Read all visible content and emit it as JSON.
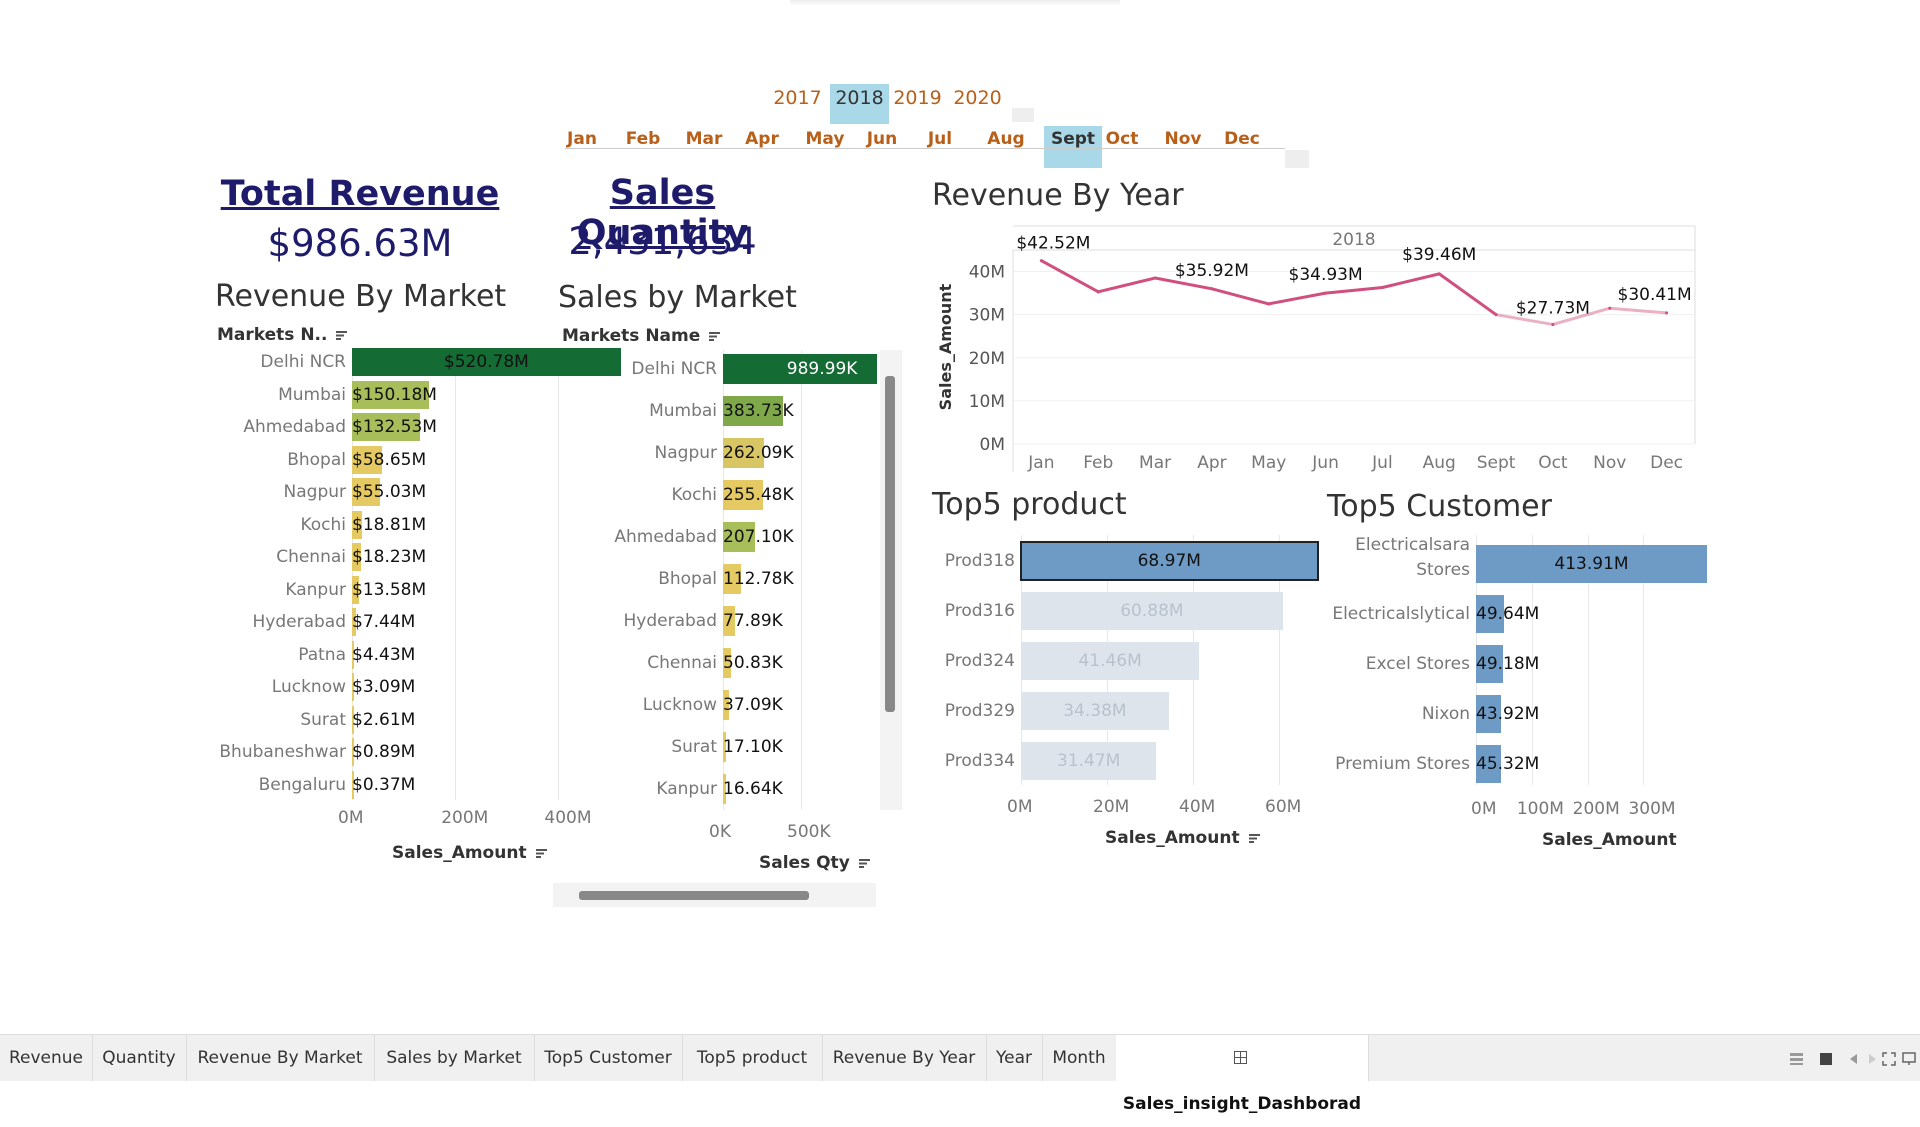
{
  "filters": {
    "years": [
      "2017",
      "2018",
      "2019",
      "2020"
    ],
    "selected_year": "2018",
    "months": [
      "Jan",
      "Feb",
      "Mar",
      "Apr",
      "May",
      "Jun",
      "Jul",
      "Aug",
      "Sept",
      "Oct",
      "Nov",
      "Dec"
    ],
    "selected_month": "Sept"
  },
  "kpis": {
    "revenue_title": "Total Revenue",
    "revenue_value": "$986.63M",
    "quantity_title": "Sales Quantity",
    "quantity_value": "2,431,634"
  },
  "chart_data": [
    {
      "id": "revenue_by_market",
      "type": "bar",
      "title": "Revenue By Market",
      "category_header": "Markets N..",
      "xlabel": "Sales_Amount",
      "xlim": [
        0,
        500
      ],
      "ticks": [
        "0M",
        "200M",
        "400M"
      ],
      "categories": [
        "Delhi NCR",
        "Mumbai",
        "Ahmedabad",
        "Bhopal",
        "Nagpur",
        "Kochi",
        "Chennai",
        "Kanpur",
        "Hyderabad",
        "Patna",
        "Lucknow",
        "Surat",
        "Bhubaneshwar",
        "Bengaluru"
      ],
      "values": [
        520.78,
        150.18,
        132.53,
        58.65,
        55.03,
        18.81,
        18.23,
        13.58,
        7.44,
        4.43,
        3.09,
        2.61,
        0.89,
        0.37
      ],
      "labels": [
        "$520.78M",
        "$150.18M",
        "$132.53M",
        "$58.65M",
        "$55.03M",
        "$18.81M",
        "$18.23M",
        "$13.58M",
        "$7.44M",
        "$4.43M",
        "$3.09M",
        "$2.61M",
        "$0.89M",
        "$0.37M"
      ],
      "colors": [
        "#156b34",
        "#a7be5a",
        "#a7be5a",
        "#e5c962",
        "#e5c962",
        "#e5c962",
        "#e5c962",
        "#e5c962",
        "#e5c962",
        "#e5c962",
        "#e5c962",
        "#e5c962",
        "#e5c962",
        "#e5c962"
      ]
    },
    {
      "id": "sales_by_market",
      "type": "bar",
      "title": "Sales by Market",
      "category_header": "Markets Name",
      "xlabel": "Sales Qty",
      "xlim": [
        0,
        1000
      ],
      "ticks": [
        "0K",
        "500K"
      ],
      "categories": [
        "Delhi NCR",
        "Mumbai",
        "Nagpur",
        "Kochi",
        "Ahmedabad",
        "Bhopal",
        "Hyderabad",
        "Chennai",
        "Lucknow",
        "Surat",
        "Kanpur"
      ],
      "values": [
        989.99,
        383.73,
        262.09,
        255.48,
        207.1,
        112.78,
        77.89,
        50.83,
        37.09,
        17.1,
        16.64
      ],
      "labels": [
        "989.99K",
        "383.73K",
        "262.09K",
        "255.48K",
        "207.10K",
        "112.78K",
        "77.89K",
        "50.83K",
        "37.09K",
        "17.10K",
        "16.64K"
      ],
      "colors": [
        "#156b34",
        "#7fa84a",
        "#d8c563",
        "#e5c962",
        "#a7be5a",
        "#e5c962",
        "#e5c962",
        "#e5c962",
        "#e5c962",
        "#e5c962",
        "#e5c962"
      ]
    },
    {
      "id": "revenue_by_year",
      "type": "line",
      "title": "Revenue By Year",
      "header": "2018",
      "ylabel": "Sales_Amount",
      "ylim": [
        0,
        45
      ],
      "yticks": [
        "0M",
        "10M",
        "20M",
        "30M",
        "40M"
      ],
      "categories": [
        "Jan",
        "Feb",
        "Mar",
        "Apr",
        "May",
        "Jun",
        "Jul",
        "Aug",
        "Sept",
        "Oct",
        "Nov",
        "Dec"
      ],
      "values": [
        42.52,
        35.3,
        38.5,
        36.0,
        32.5,
        35.0,
        36.3,
        39.46,
        30.0,
        27.73,
        31.5,
        30.41
      ],
      "point_labels": {
        "0": "$42.52M",
        "3": "$35.92M",
        "5": "$34.93M",
        "7": "$39.46M",
        "9": "$27.73M",
        "11": "$30.41M"
      }
    },
    {
      "id": "top5_product",
      "type": "bar",
      "title": "Top5 product",
      "xlabel": "Sales_Amount",
      "xlim": [
        0,
        70
      ],
      "ticks": [
        "0M",
        "20M",
        "40M",
        "60M"
      ],
      "categories": [
        "Prod318",
        "Prod316",
        "Prod324",
        "Prod329",
        "Prod334"
      ],
      "values": [
        68.97,
        60.88,
        41.46,
        34.38,
        31.47
      ],
      "labels": [
        "68.97M",
        "60.88M",
        "41.46M",
        "34.38M",
        "31.47M"
      ],
      "colors": [
        "#6e9bc6",
        "#dde4ec",
        "#dde4ec",
        "#dde4ec",
        "#dde4ec"
      ]
    },
    {
      "id": "top5_customer",
      "type": "bar",
      "title": "Top5 Customer",
      "xlabel": "Sales_Amount",
      "xlim": [
        0,
        430
      ],
      "ticks": [
        "0M",
        "100M",
        "200M",
        "300M"
      ],
      "categories": [
        "Electricalsara Stores",
        "Electricalslytical",
        "Excel Stores",
        "Nixon",
        "Premium Stores"
      ],
      "values": [
        413.91,
        49.64,
        49.18,
        43.92,
        45.32
      ],
      "labels": [
        "413.91M",
        "49.64M",
        "49.18M",
        "43.92M",
        "45.32M"
      ],
      "colors": [
        "#6e9bc6",
        "#6e9bc6",
        "#6e9bc6",
        "#6e9bc6",
        "#6e9bc6"
      ]
    }
  ],
  "tabs": [
    "Revenue",
    "Quantity",
    "Revenue By Market",
    "Sales by Market",
    "Top5 Customer",
    "Top5 product",
    "Revenue By Year",
    "Year",
    "Month",
    "Sales_insight_Dashborad"
  ],
  "active_tab": "Sales_insight_Dashborad",
  "tab_icon": "dashboard-grid-icon"
}
